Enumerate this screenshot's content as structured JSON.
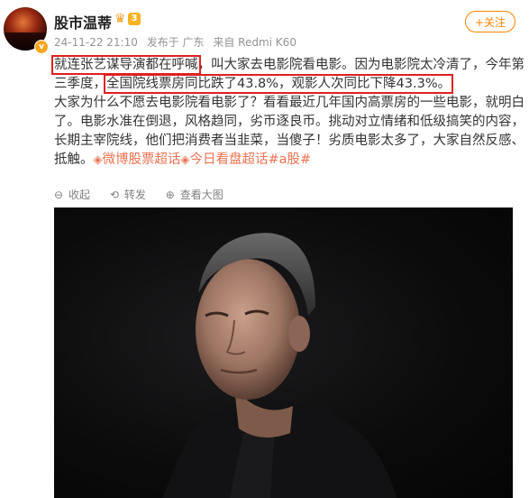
{
  "post": {
    "username": "股市温蒂",
    "level_badge": "3",
    "verified_mark": "v",
    "meta": {
      "time": "24-11-22 21:10",
      "publish_from": "发布于 广东",
      "device": "来自 Redmi K60"
    },
    "follow_label": "+关注",
    "text_lines": [
      {
        "highlight": "就连张艺谋导演都在呼喊",
        "rest": "，叫大家去电影院看电影。因为电影院太冷清了，今年第"
      },
      {
        "pre": "三季度，",
        "highlight": "全国院线票房同比跌了43.8%，观影人次同比下降43.3%。"
      },
      {
        "text": "大家为什么不愿去电影院看电影了？看看最近几年国内高票房的一些电影，就明白"
      },
      {
        "text": "了。电影水准在倒退，风格趋同，劣币逐良币。挑动对立情绪和低级搞笑的内容，"
      },
      {
        "text": "长期主宰院线，他们把消费者当韭菜，当傻子！劣质电影太多了，大家自然反感、"
      }
    ],
    "last_line_start": "抵触。",
    "super_topics": [
      "微博股票超话",
      "今日看盘超话"
    ],
    "hashtag": "#a股#",
    "toolbar": {
      "collapse": "收起",
      "repost": "转发",
      "view_image": "查看大图"
    },
    "icons": {
      "crown": "crown-icon",
      "topic": "super-topic-icon",
      "collapse": "collapse-icon",
      "repost": "repost-icon",
      "view": "view-image-icon"
    },
    "colors": {
      "accent": "#ff8200",
      "topic": "#eb7350",
      "highlight_box": "#e02020",
      "meta_gray": "#939393"
    }
  }
}
